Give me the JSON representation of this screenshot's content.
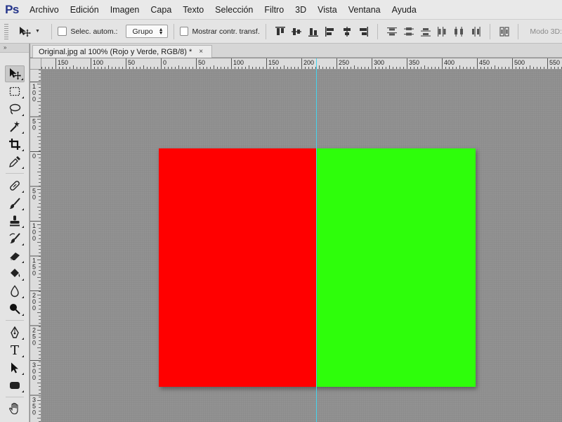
{
  "app": {
    "logo": "Ps",
    "menu": [
      "Archivo",
      "Edición",
      "Imagen",
      "Capa",
      "Texto",
      "Selección",
      "Filtro",
      "3D",
      "Vista",
      "Ventana",
      "Ayuda"
    ]
  },
  "options": {
    "auto_select_label": "Selec. autom.:",
    "auto_select_checked": false,
    "group_select": "Grupo",
    "show_transform_label": "Mostrar contr. transf.",
    "show_transform_checked": false,
    "mode3d_label": "Modo 3D:"
  },
  "toolbar": {
    "collapse_label": "»",
    "tools": [
      {
        "name": "move-tool",
        "icon": "move-icon",
        "active": true
      },
      {
        "name": "marquee-tool",
        "icon": "rect-marquee-icon"
      },
      {
        "name": "lasso-tool",
        "icon": "lasso-icon"
      },
      {
        "name": "quick-select-tool",
        "icon": "magic-wand-icon"
      },
      {
        "name": "crop-tool",
        "icon": "crop-icon"
      },
      {
        "name": "eyedropper-tool",
        "icon": "eyedropper-icon"
      },
      {
        "name": "healing-tool",
        "icon": "bandage-icon"
      },
      {
        "name": "brush-tool",
        "icon": "brush-icon"
      },
      {
        "name": "stamp-tool",
        "icon": "stamp-icon"
      },
      {
        "name": "history-brush-tool",
        "icon": "history-brush-icon"
      },
      {
        "name": "eraser-tool",
        "icon": "eraser-icon"
      },
      {
        "name": "paint-bucket-tool",
        "icon": "paint-bucket-icon"
      },
      {
        "name": "blur-tool",
        "icon": "drop-icon"
      },
      {
        "name": "dodge-tool",
        "icon": "dodge-icon"
      },
      {
        "name": "pen-tool",
        "icon": "pen-icon"
      },
      {
        "name": "type-tool",
        "icon": "type-icon"
      },
      {
        "name": "path-select-tool",
        "icon": "arrow-icon"
      },
      {
        "name": "shape-tool",
        "icon": "rounded-rect-icon"
      },
      {
        "name": "hand-tool",
        "icon": "hand-icon"
      }
    ],
    "type_glyph": "T"
  },
  "document": {
    "tab_title": "Original.jpg al 100% (Rojo y Verde, RGB/8) *",
    "close_glyph": "×",
    "left_color": "#ff0000",
    "right_color": "#2efe0b",
    "guide_color": "#45d4ee"
  },
  "rulers": {
    "top_labels": [
      "150",
      "100",
      "50",
      "0",
      "50",
      "100",
      "150",
      "200",
      "250",
      "300",
      "350",
      "400",
      "450",
      "500",
      "550"
    ],
    "left_labels": [
      "1\n0\n0",
      "5\n0",
      "0",
      "5\n0",
      "1\n0\n0",
      "1\n5\n0",
      "2\n0\n0",
      "2\n5\n0",
      "3\n0\n0",
      "3\n5\n0"
    ]
  }
}
